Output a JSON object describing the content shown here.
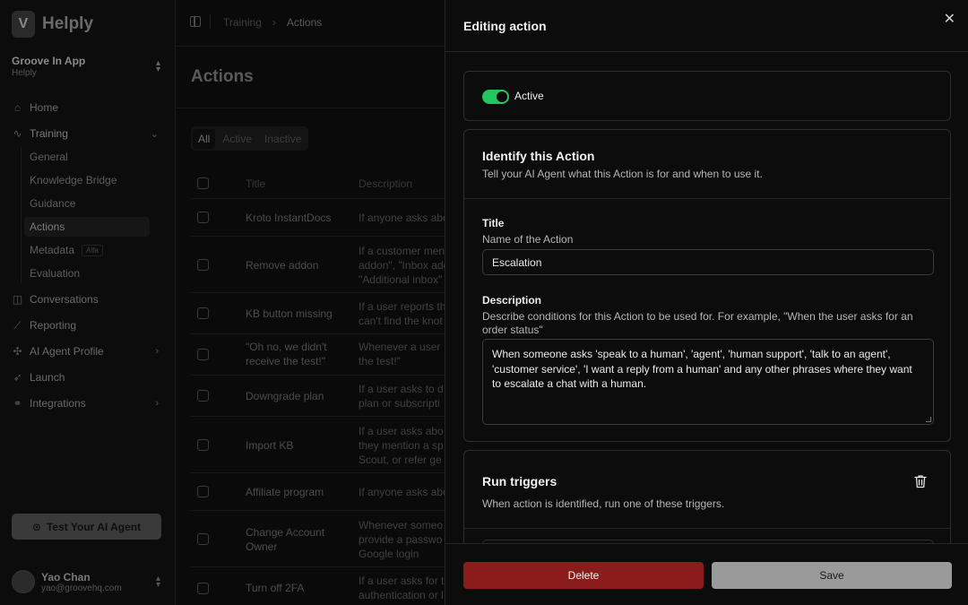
{
  "brand": {
    "name": "Helply",
    "logo_icon": "helply-logo-icon"
  },
  "workspace": {
    "name": "Groove In App",
    "sub": "Helply"
  },
  "nav": {
    "home": "Home",
    "training": "Training",
    "training_sub": [
      "General",
      "Knowledge Bridge",
      "Guidance",
      "Actions",
      "Metadata",
      "Evaluation"
    ],
    "metadata_badge": "Alfa",
    "conversations": "Conversations",
    "reporting": "Reporting",
    "agent_profile": "AI Agent Profile",
    "launch": "Launch",
    "integrations": "Integrations"
  },
  "test_button": "Test Your AI Agent",
  "user": {
    "name": "Yao Chan",
    "email": "yao@groovehq.com"
  },
  "breadcrumb": {
    "parent": "Training",
    "current": "Actions"
  },
  "page": {
    "title": "Actions",
    "tabs": [
      "All",
      "Active",
      "Inactive"
    ],
    "columns": {
      "title": "Title",
      "description": "Description"
    },
    "rows": [
      {
        "title": "Kroto InstantDocs",
        "desc": "If anyone asks abo"
      },
      {
        "title": "Remove addon",
        "desc": "If a customer men\naddon\", \"Inbox add\n\"Additional inbox\""
      },
      {
        "title": "KB button missing",
        "desc": "If a user reports th\ncan't find the knot"
      },
      {
        "title": "\"Oh no, we didn't receive the test!\"",
        "desc": "Whenever a user\nthe test!\""
      },
      {
        "title": "Downgrade plan",
        "desc": "If a user asks to d\nplan or subscripti"
      },
      {
        "title": "Import KB",
        "desc": "If a user asks abo\nthey mention a sp\nScout, or refer ge"
      },
      {
        "title": "Affiliate program",
        "desc": "If anyone asks abo"
      },
      {
        "title": "Change Account Owner",
        "desc": "Whenever someo\nprovide a passwo\nGoogle login"
      },
      {
        "title": "Turn off 2FA",
        "desc": "If a user asks for t\nauthentication or l"
      }
    ]
  },
  "drawer": {
    "title": "Editing action",
    "active_label": "Active",
    "active_on": true,
    "toggle_color": "#22c55e",
    "identify": {
      "heading": "Identify this Action",
      "sub": "Tell your AI Agent what this Action is for and when to use it.",
      "title_label": "Title",
      "title_help": "Name of the Action",
      "title_value": "Escalation",
      "desc_label": "Description",
      "desc_help": "Describe conditions for this Action to be used for. For example, \"When the user asks for an order status\"",
      "desc_value": "When someone asks 'speak to a human', 'agent', 'human support', 'talk to an agent', 'customer service', 'I want a reply from a human' and any other phrases where they want to escalate a chat with a human."
    },
    "triggers": {
      "heading": "Run triggers",
      "sub": "When action is identified, run one of these triggers."
    },
    "delete_label": "Delete",
    "save_label": "Save",
    "delete_color": "#8b1c1c"
  }
}
